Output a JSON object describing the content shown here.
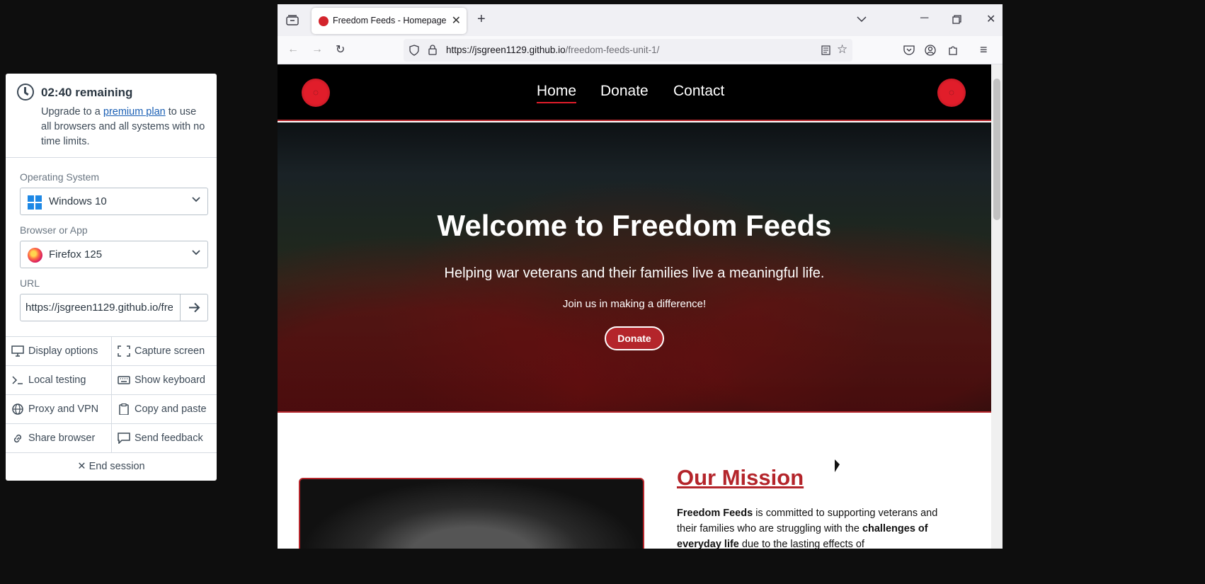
{
  "panel": {
    "timer_title": "02:40 remaining",
    "timer_text_before": "Upgrade to a ",
    "timer_link": "premium plan",
    "timer_text_after": " to use all browsers and all systems with no time limits.",
    "os_label": "Operating System",
    "os_value": "Windows 10",
    "browser_label": "Browser or App",
    "browser_value": "Firefox 125",
    "url_label": "URL",
    "url_value": "https://jsgreen1129.github.io/freedom-feeds-unit-1/",
    "buttons": [
      {
        "label": "Display options",
        "icon": "monitor-icon"
      },
      {
        "label": "Capture screen",
        "icon": "capture-icon"
      },
      {
        "label": "Local testing",
        "icon": "terminal-icon"
      },
      {
        "label": "Show keyboard",
        "icon": "keyboard-icon"
      },
      {
        "label": "Proxy and VPN",
        "icon": "globe-icon"
      },
      {
        "label": "Copy and paste",
        "icon": "clipboard-icon"
      },
      {
        "label": "Share browser",
        "icon": "link-icon"
      },
      {
        "label": "Send feedback",
        "icon": "chat-icon"
      }
    ],
    "end_session": "End session"
  },
  "browser": {
    "tab_title": "Freedom Feeds - Homepage",
    "url_host": "https://jsgreen1129.github.io",
    "url_path": "/freedom-feeds-unit-1/"
  },
  "site": {
    "nav": [
      "Home",
      "Donate",
      "Contact"
    ],
    "hero_title": "Welcome to Freedom Feeds",
    "hero_sub": "Helping war veterans and their families live a meaningful life.",
    "hero_small": "Join us in making a difference!",
    "hero_button": "Donate",
    "mission_title": "Our Mission",
    "mission_brand": "Freedom Feeds",
    "mission_text_1": " is committed to supporting veterans and their families who are struggling with the ",
    "mission_bold_2": "challenges of everyday life",
    "mission_text_2": " due to the lasting effects of"
  },
  "colors": {
    "accent_red": "#b4252b",
    "link_blue": "#1a5fb4"
  }
}
